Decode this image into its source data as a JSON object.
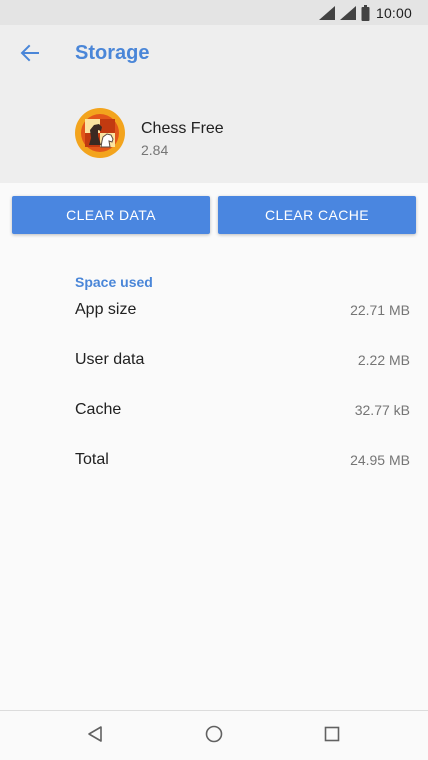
{
  "status_bar": {
    "time": "10:00",
    "icons": [
      "wifi-icon",
      "cellular-signal-icon",
      "battery-icon"
    ]
  },
  "header": {
    "back_icon": "arrow-back-icon",
    "title": "Storage"
  },
  "app": {
    "icon": "chess-app-icon",
    "name": "Chess Free",
    "version": "2.84"
  },
  "buttons": {
    "clear_data": "CLEAR DATA",
    "clear_cache": "CLEAR CACHE"
  },
  "space_used": {
    "header": "Space used",
    "rows": [
      {
        "label": "App size",
        "value": "22.71 MB"
      },
      {
        "label": "User data",
        "value": "2.22 MB"
      },
      {
        "label": "Cache",
        "value": "32.77 kB"
      },
      {
        "label": "Total",
        "value": "24.95 MB"
      }
    ]
  },
  "nav_bar": {
    "icons": [
      "nav-back-icon",
      "nav-home-icon",
      "nav-recents-icon"
    ]
  },
  "colors": {
    "accent": "#4a86d8",
    "button": "#4a86e0",
    "header_bg": "#eeeeee",
    "status_bar_bg": "#e4e4e4",
    "page_bg": "#fafafa"
  }
}
